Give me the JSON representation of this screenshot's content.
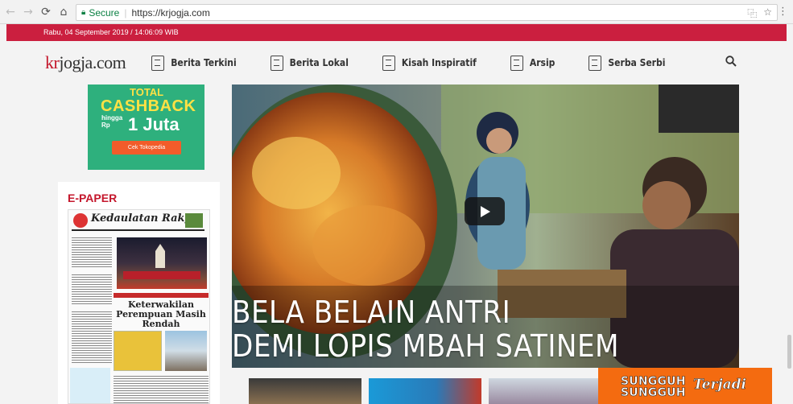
{
  "browser": {
    "secure_label": "Secure",
    "url": "https://krjogja.com"
  },
  "topbar": {
    "datetime": "Rabu, 04 September 2019 / 14:06:09 WIB"
  },
  "nav": {
    "logo_prefix": "kr",
    "logo_rest": "jogja.com",
    "items": [
      {
        "label": "Berita Terkini"
      },
      {
        "label": "Berita Lokal"
      },
      {
        "label": "Kisah Inspiratif"
      },
      {
        "label": "Arsip"
      },
      {
        "label": "Serba Serbi"
      }
    ]
  },
  "ad": {
    "total": "TOTAL",
    "cashback": "CASHBACK",
    "hingga": "hingga",
    "rp": "Rp",
    "amount": "1 Juta",
    "cta": "Cek Tokopedia"
  },
  "epaper": {
    "title": "E-PAPER",
    "masthead": "Kedaulatan Rakyat",
    "headline": "Keterwakilan Perempuan Masih Rendah"
  },
  "video": {
    "title_line1": "BELA BELAIN ANTRI",
    "title_line2": "DEMI LOPIS MBAH SATINEM"
  },
  "promo": {
    "line1": "SUNGGUH",
    "line2": "SUNGGUH",
    "script": "Terjadi"
  },
  "colors": {
    "brand_red": "#cb1f3f",
    "ad_green": "#2eb07d",
    "promo_orange": "#f46b10"
  }
}
